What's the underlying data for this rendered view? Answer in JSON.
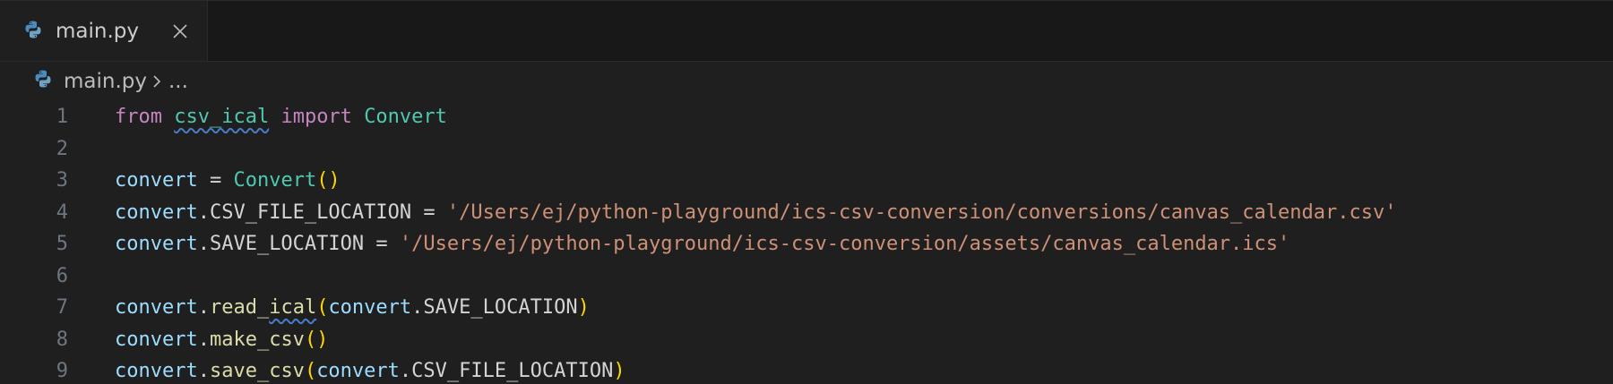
{
  "tab": {
    "label": "main.py",
    "icon": "python-file-icon",
    "close_icon": "close-icon"
  },
  "breadcrumb": {
    "file": "main.py",
    "ellipsis": "..."
  },
  "colors": {
    "background": "#1f1f1f",
    "keyword": "#c586c0",
    "class": "#4ec9b0",
    "variable": "#9cdcfe",
    "function": "#dcdcaa",
    "string": "#ce9178",
    "bracket": "#ffd700",
    "squiggle": "#4a7cc9"
  },
  "editor": {
    "lines": [
      {
        "n": "1",
        "tokens": [
          {
            "t": "from",
            "c": "kw"
          },
          {
            "t": " ",
            "c": "plain"
          },
          {
            "t": "csv_ical",
            "c": "mod",
            "squiggle": true
          },
          {
            "t": " ",
            "c": "plain"
          },
          {
            "t": "import",
            "c": "kw"
          },
          {
            "t": " ",
            "c": "plain"
          },
          {
            "t": "Convert",
            "c": "cls"
          }
        ]
      },
      {
        "n": "2",
        "tokens": []
      },
      {
        "n": "3",
        "tokens": [
          {
            "t": "convert",
            "c": "var"
          },
          {
            "t": " = ",
            "c": "plain"
          },
          {
            "t": "Convert",
            "c": "cls"
          },
          {
            "t": "()",
            "c": "paren"
          }
        ]
      },
      {
        "n": "4",
        "tokens": [
          {
            "t": "convert",
            "c": "var"
          },
          {
            "t": ".CSV_FILE_LOCATION = ",
            "c": "plain"
          },
          {
            "t": "'/Users/ej/python-playground/ics-csv-conversion/conversions/canvas_calendar.csv'",
            "c": "str"
          }
        ]
      },
      {
        "n": "5",
        "tokens": [
          {
            "t": "convert",
            "c": "var"
          },
          {
            "t": ".SAVE_LOCATION = ",
            "c": "plain"
          },
          {
            "t": "'/Users/ej/python-playground/ics-csv-conversion/assets/canvas_calendar.ics'",
            "c": "str"
          }
        ]
      },
      {
        "n": "6",
        "tokens": []
      },
      {
        "n": "7",
        "tokens": [
          {
            "t": "convert",
            "c": "var"
          },
          {
            "t": ".",
            "c": "plain"
          },
          {
            "t": "read_",
            "c": "fn"
          },
          {
            "t": "ical",
            "c": "fn",
            "squiggle": true
          },
          {
            "t": "(",
            "c": "paren"
          },
          {
            "t": "convert",
            "c": "var"
          },
          {
            "t": ".SAVE_LOCATION",
            "c": "plain"
          },
          {
            "t": ")",
            "c": "paren"
          }
        ]
      },
      {
        "n": "8",
        "tokens": [
          {
            "t": "convert",
            "c": "var"
          },
          {
            "t": ".",
            "c": "plain"
          },
          {
            "t": "make_csv",
            "c": "fn"
          },
          {
            "t": "()",
            "c": "paren"
          }
        ]
      },
      {
        "n": "9",
        "tokens": [
          {
            "t": "convert",
            "c": "var"
          },
          {
            "t": ".",
            "c": "plain"
          },
          {
            "t": "save_csv",
            "c": "fn"
          },
          {
            "t": "(",
            "c": "paren"
          },
          {
            "t": "convert",
            "c": "var"
          },
          {
            "t": ".CSV_FILE_LOCATION",
            "c": "plain"
          },
          {
            "t": ")",
            "c": "paren"
          }
        ]
      }
    ]
  }
}
